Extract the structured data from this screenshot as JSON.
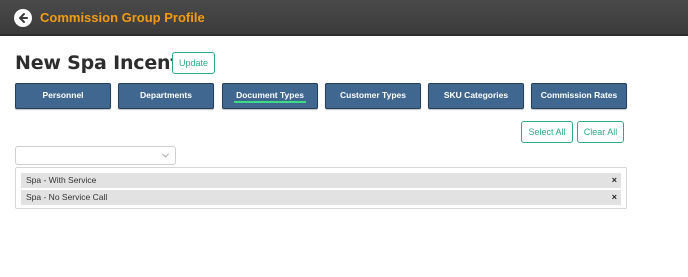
{
  "header": {
    "title": "Commission Group Profile",
    "back_icon": "back-arrow-icon",
    "accent_color": "#f39c12",
    "bar_color": "#444444"
  },
  "page": {
    "title": "New Spa Incentive",
    "update_label": "Update"
  },
  "tabs": [
    {
      "label": "Personnel",
      "active": false
    },
    {
      "label": "Departments",
      "active": false
    },
    {
      "label": "Document Types",
      "active": true
    },
    {
      "label": "Customer Types",
      "active": false
    },
    {
      "label": "SKU Categories",
      "active": false
    },
    {
      "label": "Commission Rates",
      "active": false
    }
  ],
  "actions": {
    "select_all_label": "Select All",
    "clear_all_label": "Clear All"
  },
  "dropdown": {
    "value": "",
    "icon": "chevron-down-icon"
  },
  "selected_items": [
    {
      "label": "Spa - With Service",
      "remove_label": "×"
    },
    {
      "label": "Spa - No Service Call",
      "remove_label": "×"
    }
  ],
  "colors": {
    "tab_bg": "#3f6790",
    "active_indicator": "#3ddc84",
    "outline_button": "#2aa98c"
  }
}
